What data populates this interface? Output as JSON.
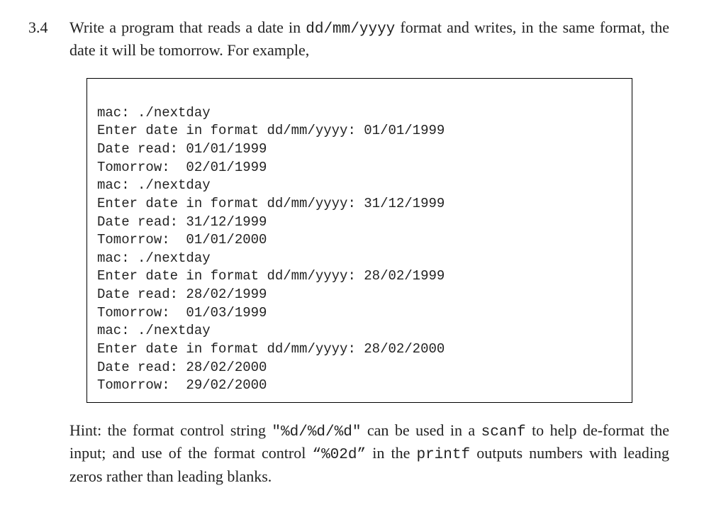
{
  "exercise": {
    "number": "3.4",
    "prompt_pre": "Write a program that reads a date in ",
    "prompt_code": "dd/mm/yyyy",
    "prompt_post": " format and writes, in the same format, the date it will be tomorrow. For example,"
  },
  "code_lines": [
    "mac: ./nextday",
    "Enter date in format dd/mm/yyyy: 01/01/1999",
    "Date read: 01/01/1999",
    "Tomorrow:  02/01/1999",
    "mac: ./nextday",
    "Enter date in format dd/mm/yyyy: 31/12/1999",
    "Date read: 31/12/1999",
    "Tomorrow:  01/01/2000",
    "mac: ./nextday",
    "Enter date in format dd/mm/yyyy: 28/02/1999",
    "Date read: 28/02/1999",
    "Tomorrow:  01/03/1999",
    "mac: ./nextday",
    "Enter date in format dd/mm/yyyy: 28/02/2000",
    "Date read: 28/02/2000",
    "Tomorrow:  29/02/2000"
  ],
  "hint": {
    "p1": "Hint: the format control string ",
    "c1": "\"%d/%d/%d\"",
    "p2": " can be used in a ",
    "c2": "scanf",
    "p3": " to help de-format the input; and use of the format control ",
    "c3": "“%02d”",
    "p4": " in the ",
    "c4": "printf",
    "p5": " outputs numbers with leading zeros rather than leading blanks."
  }
}
